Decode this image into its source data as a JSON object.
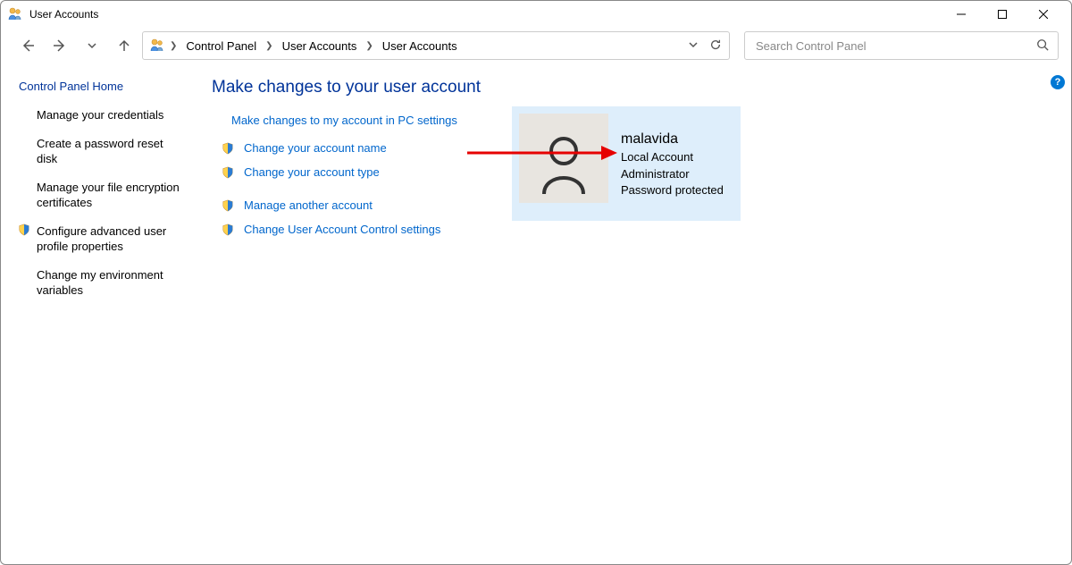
{
  "window": {
    "title": "User Accounts"
  },
  "breadcrumbs": {
    "item0": "Control Panel",
    "item1": "User Accounts",
    "item2": "User Accounts"
  },
  "search": {
    "placeholder": "Search Control Panel"
  },
  "sidebar": {
    "home": "Control Panel Home",
    "items": {
      "0": "Manage your credentials",
      "1": "Create a password reset disk",
      "2": "Manage your file encryption certificates",
      "3": "Configure advanced user profile properties",
      "4": "Change my environment variables"
    }
  },
  "main": {
    "heading": "Make changes to your user account",
    "pc_settings_link": "Make changes to my account in PC settings",
    "links": {
      "0": "Change your account name",
      "1": "Change your account type",
      "2": "Manage another account",
      "3": "Change User Account Control settings"
    }
  },
  "account": {
    "name": "malavida",
    "type": "Local Account",
    "role": "Administrator",
    "protection": "Password protected"
  }
}
